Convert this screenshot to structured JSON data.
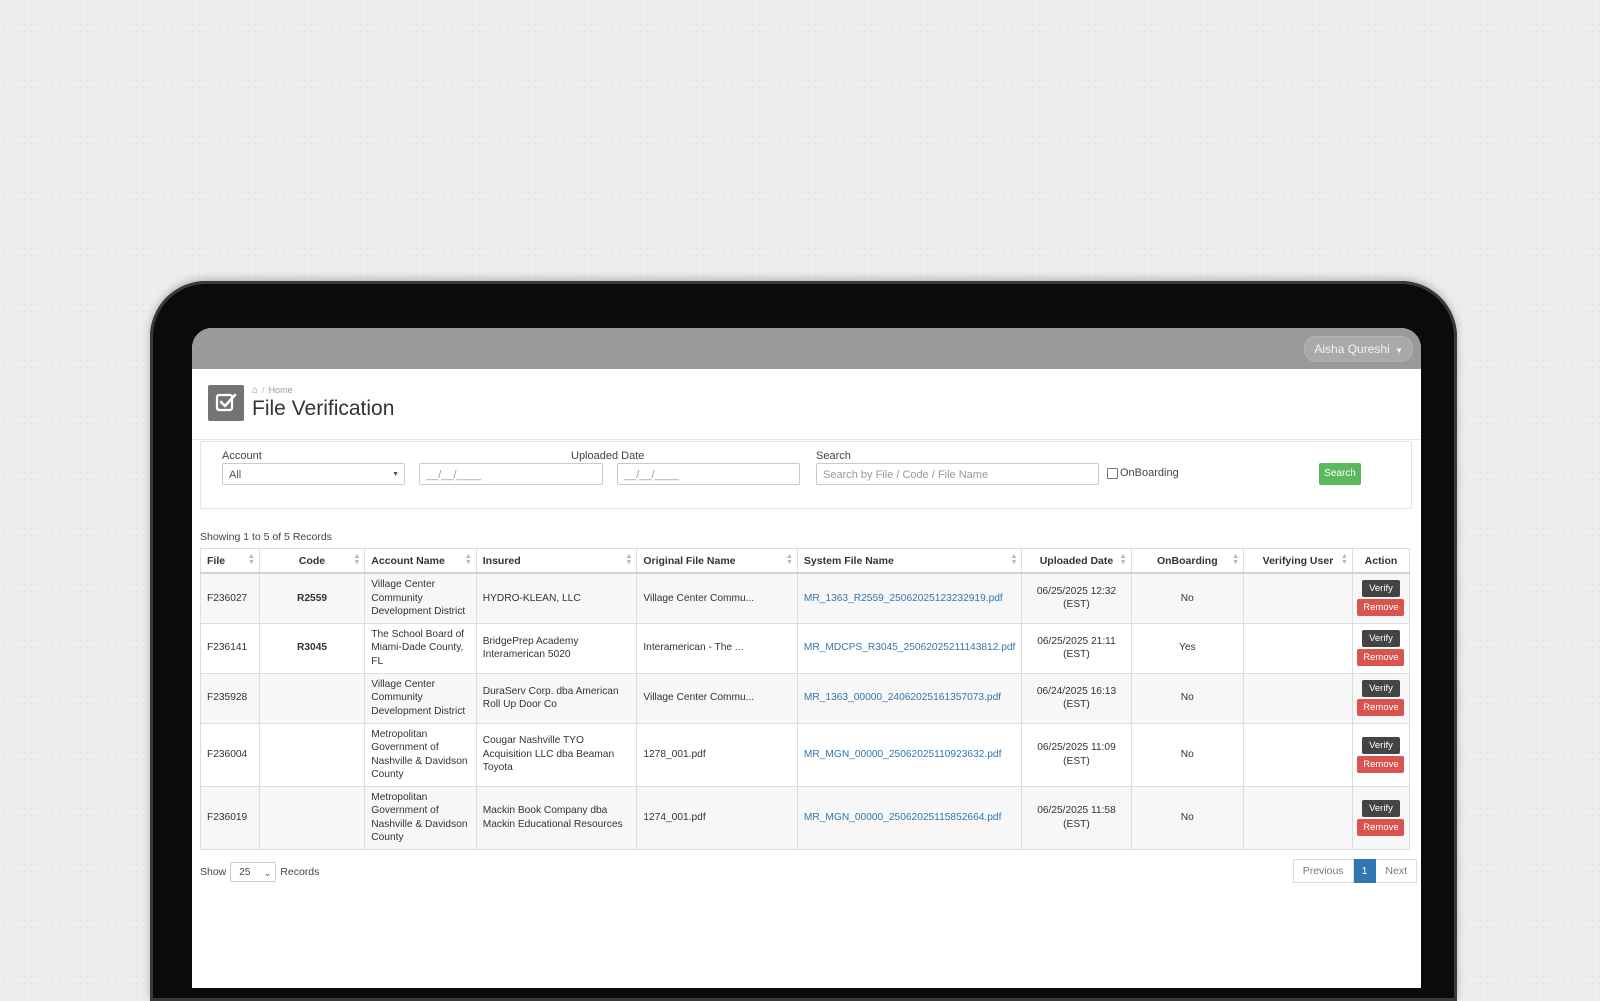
{
  "user": {
    "name": "Aisha Qureshi"
  },
  "breadcrumb": {
    "home": "Home"
  },
  "page": {
    "title": "File Verification"
  },
  "filters": {
    "account_label": "Account",
    "account_value": "All",
    "uploaded_date_label": "Uploaded Date",
    "date_from_placeholder": "__/__/____",
    "date_to_placeholder": "__/__/____",
    "search_label": "Search",
    "search_placeholder": "Search by File / Code / File Name",
    "onboarding_label": "OnBoarding",
    "search_button": "Search"
  },
  "table": {
    "showing": "Showing 1 to 5 of 5 Records",
    "columns": [
      "File",
      "Code",
      "Account Name",
      "Insured",
      "Original File Name",
      "System File Name",
      "Uploaded Date",
      "OnBoarding",
      "Verifying User",
      "Action"
    ],
    "rows": [
      {
        "file": "F236027",
        "code": "R2559",
        "account": "Village Center Community Development District",
        "insured": "HYDRO-KLEAN, LLC",
        "original": "Village Center Commu...",
        "system": "MR_1363_R2559_25062025123232919.pdf",
        "uploaded": "06/25/2025 12:32 (EST)",
        "onboarding": "No",
        "verifying_user": "",
        "verify": "Verify",
        "remove": "Remove"
      },
      {
        "file": "F236141",
        "code": "R3045",
        "account": "The School Board of Miami-Dade County, FL",
        "insured": "BridgePrep Academy Interamerican 5020",
        "original": "Interamerican - The ...",
        "system": "MR_MDCPS_R3045_25062025211143812.pdf",
        "uploaded": "06/25/2025 21:11 (EST)",
        "onboarding": "Yes",
        "verifying_user": "",
        "verify": "Verify",
        "remove": "Remove"
      },
      {
        "file": "F235928",
        "code": "",
        "account": "Village Center Community Development District",
        "insured": "DuraServ Corp. dba American Roll Up Door Co",
        "original": "Village Center Commu...",
        "system": "MR_1363_00000_24062025161357073.pdf",
        "uploaded": "06/24/2025 16:13 (EST)",
        "onboarding": "No",
        "verifying_user": "",
        "verify": "Verify",
        "remove": "Remove"
      },
      {
        "file": "F236004",
        "code": "",
        "account": "Metropolitan Government of Nashville & Davidson County",
        "insured": "Cougar Nashville TYO Acquisition LLC dba Beaman Toyota",
        "original": "1278_001.pdf",
        "system": "MR_MGN_00000_25062025110923632.pdf",
        "uploaded": "06/25/2025 11:09 (EST)",
        "onboarding": "No",
        "verifying_user": "",
        "verify": "Verify",
        "remove": "Remove"
      },
      {
        "file": "F236019",
        "code": "",
        "account": "Metropolitan Government of Nashville & Davidson County",
        "insured": "Mackin Book Company dba Mackin Educational Resources",
        "original": "1274_001.pdf",
        "system": "MR_MGN_00000_25062025115852664.pdf",
        "uploaded": "06/25/2025 11:58 (EST)",
        "onboarding": "No",
        "verifying_user": "",
        "verify": "Verify",
        "remove": "Remove"
      }
    ]
  },
  "footer": {
    "show_label": "Show",
    "page_length": "25",
    "records_label": "Records",
    "previous": "Previous",
    "current_page": "1",
    "next": "Next"
  },
  "colors": {
    "primary": "#3276b1",
    "success": "#5cb85c",
    "danger": "#d9534f",
    "dark_button": "#444444",
    "topbar": "#9a9a9a"
  }
}
